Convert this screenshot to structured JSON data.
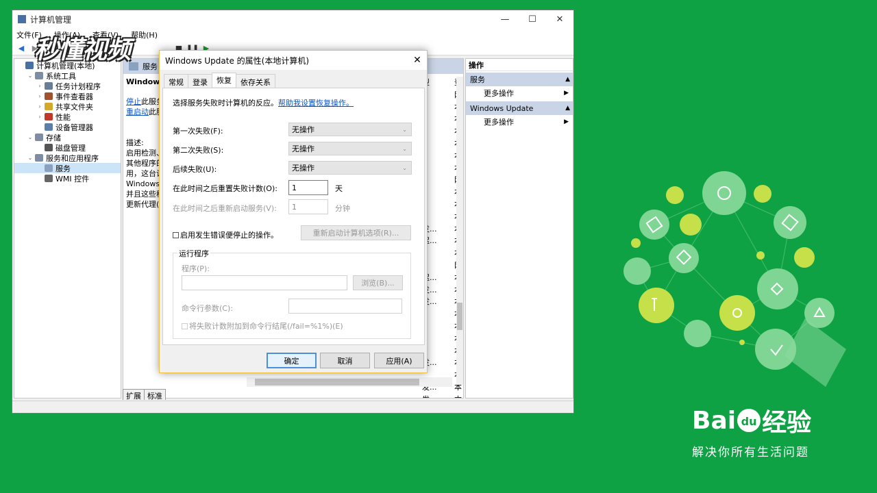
{
  "window": {
    "title": "计算机管理",
    "min": "—",
    "max": "☐",
    "close": "✕"
  },
  "menu": [
    "文件(F)",
    "操作(A)",
    "查看(V)",
    "帮助(H)"
  ],
  "watermark": "秒懂视频",
  "tree": [
    {
      "label": "计算机管理(本地)",
      "level": 0,
      "expander": "",
      "color": "#4a6fa5"
    },
    {
      "label": "系统工具",
      "level": 1,
      "expander": "⌄",
      "color": "#7d8da3"
    },
    {
      "label": "任务计划程序",
      "level": 2,
      "expander": "›",
      "color": "#6a7d96"
    },
    {
      "label": "事件查看器",
      "level": 2,
      "expander": "›",
      "color": "#a0522d"
    },
    {
      "label": "共享文件夹",
      "level": 2,
      "expander": "›",
      "color": "#d4a82b"
    },
    {
      "label": "性能",
      "level": 2,
      "expander": "›",
      "color": "#c0392b"
    },
    {
      "label": "设备管理器",
      "level": 2,
      "expander": "",
      "color": "#5b7fa8"
    },
    {
      "label": "存储",
      "level": 1,
      "expander": "⌄",
      "color": "#7d8da3"
    },
    {
      "label": "磁盘管理",
      "level": 2,
      "expander": "",
      "color": "#555"
    },
    {
      "label": "服务和应用程序",
      "level": 1,
      "expander": "⌄",
      "color": "#7d8da3"
    },
    {
      "label": "服务",
      "level": 2,
      "expander": "",
      "color": "#8aa1bf",
      "selected": true
    },
    {
      "label": "WMI 控件",
      "level": 2,
      "expander": "",
      "color": "#666"
    }
  ],
  "center": {
    "header": "服务",
    "desc_title": "Windows",
    "stop_link": "停止",
    "stop_rest": "此服务",
    "restart_link": "重启动",
    "restart_rest": "此服",
    "desc_label": "描述:",
    "desc_lines": [
      "启用检测、",
      "其他程序的",
      "用，这台计",
      "Windows",
      "并且这些程",
      "更新代理(W"
    ],
    "col_header": [
      "型",
      "登"
    ],
    "rows": [
      [
        "",
        "网"
      ],
      [
        "",
        "本"
      ],
      [
        "",
        "本"
      ],
      [
        "",
        "本"
      ],
      [
        "",
        "本"
      ],
      [
        "",
        "本"
      ],
      [
        "",
        "本"
      ],
      [
        "",
        "网"
      ],
      [
        "",
        "本"
      ],
      [
        "",
        "本"
      ],
      [
        "",
        "本"
      ],
      [
        "发...",
        "本"
      ],
      [
        "迟...",
        "本"
      ],
      [
        "",
        "本"
      ],
      [
        "",
        "网"
      ],
      [
        "迟...",
        "本"
      ],
      [
        "发...",
        "本"
      ],
      [
        "发...",
        "本"
      ],
      [
        "",
        "本"
      ],
      [
        "",
        "本"
      ],
      [
        "",
        "本"
      ],
      [
        "",
        "本"
      ],
      [
        "发...",
        "本"
      ],
      [
        "",
        "本"
      ],
      [
        "发...",
        "本"
      ],
      [
        "发...",
        "本"
      ],
      [
        "发...",
        "本"
      ],
      [
        "",
        "本"
      ]
    ]
  },
  "bottom_tabs": [
    "扩展",
    "标准"
  ],
  "actions": {
    "header": "操作",
    "sections": [
      {
        "title": "服务",
        "items": [
          "更多操作"
        ]
      },
      {
        "title": "Windows Update",
        "items": [
          "更多操作"
        ]
      }
    ]
  },
  "dialog": {
    "title": "Windows Update 的属性(本地计算机)",
    "close": "✕",
    "tabs": [
      "常规",
      "登录",
      "恢复",
      "依存关系"
    ],
    "active_tab": 2,
    "intro": "选择服务失败时计算机的反应。",
    "help_link": "帮助我设置恢复操作。",
    "first_label": "第一次失败(F):",
    "first_value": "无操作",
    "second_label": "第二次失败(S):",
    "second_value": "无操作",
    "subsequent_label": "后续失败(U):",
    "subsequent_value": "无操作",
    "reset_label": "在此时间之后重置失败计数(O):",
    "reset_value": "1",
    "reset_unit": "天",
    "restart_label": "在此时间之后重新启动服务(V):",
    "restart_value": "1",
    "restart_unit": "分钟",
    "enable_stop_label": "启用发生错误便停止的操作。",
    "restart_options_btn": "重新启动计算机选项(R)...",
    "run_group_title": "运行程序",
    "program_label": "程序(P):",
    "program_value": "",
    "browse_btn": "浏览(B)...",
    "cmd_label": "命令行参数(C):",
    "cmd_value": "",
    "append_label": "将失败计数附加到命令行结尾(/fail=%1%)(E)",
    "ok": "确定",
    "cancel": "取消",
    "apply": "应用(A)"
  },
  "baidu": {
    "logo_left": "Bai",
    "logo_mid": "du",
    "logo_right": "经验",
    "slogan": "解决你所有生活问题"
  }
}
